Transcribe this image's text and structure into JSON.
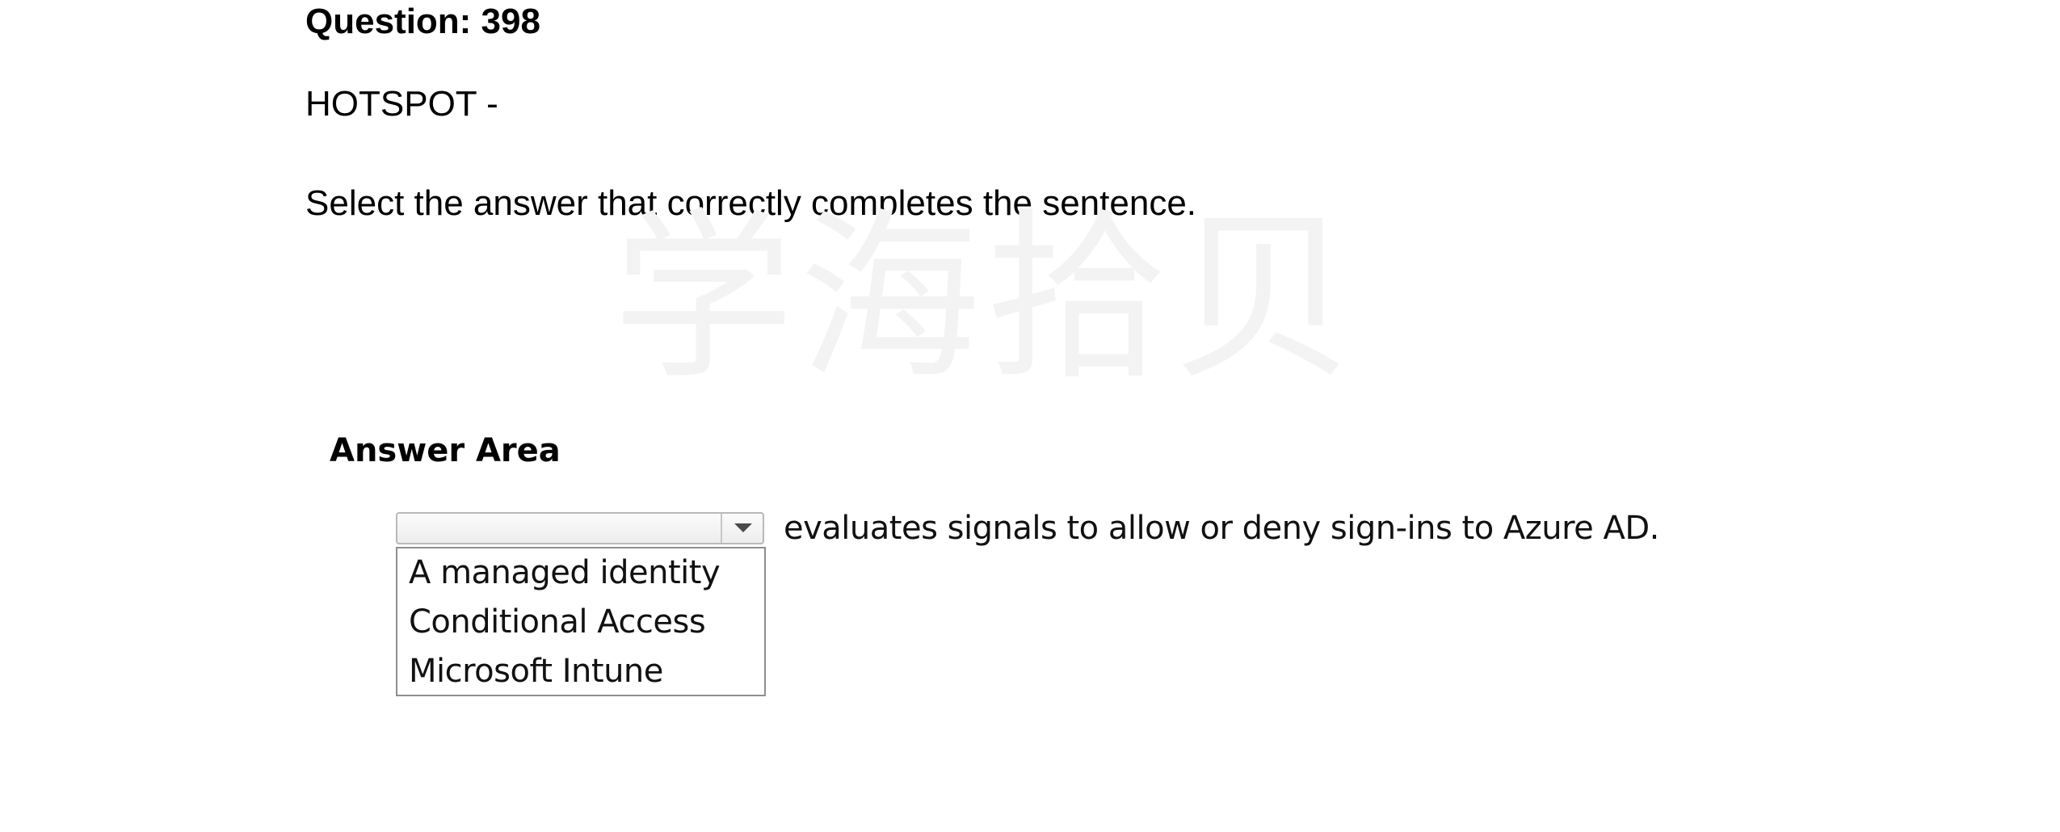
{
  "question": {
    "title": "Question: 398",
    "type": "HOTSPOT -",
    "instruction": "Select the answer that correctly completes the sentence."
  },
  "watermark": {
    "text": "学海拾贝"
  },
  "answer_area": {
    "title": "Answer Area",
    "dropdown": {
      "selected_value": "",
      "icon": "chevron-down-icon"
    },
    "sentence": "evaluates signals to allow or deny sign-ins to Azure AD.",
    "options": [
      "A managed identity",
      "Conditional Access",
      "Microsoft Intune"
    ]
  }
}
